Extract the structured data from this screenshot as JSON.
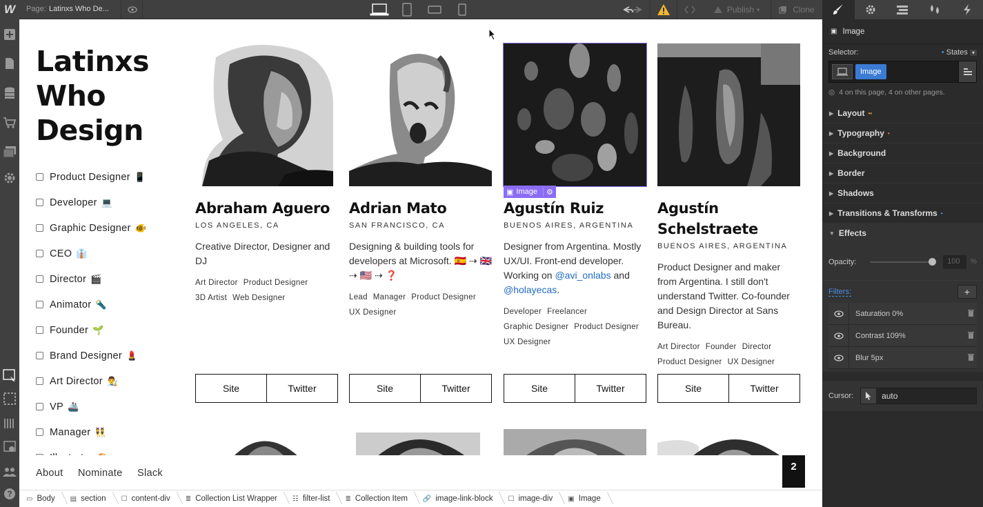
{
  "topbar": {
    "logo": "W",
    "page_label": "Page:",
    "page_name": "Latinxs Who De...",
    "publish_label": "Publish",
    "clone_label": "Clone"
  },
  "site": {
    "title_lines": [
      "Latinxs",
      "Who",
      "Design"
    ],
    "filters": [
      {
        "label": "Product Designer",
        "emoji": "📱"
      },
      {
        "label": "Developer",
        "emoji": "💻"
      },
      {
        "label": "Graphic Designer",
        "emoji": "🐠"
      },
      {
        "label": "CEO",
        "emoji": "👔"
      },
      {
        "label": "Director",
        "emoji": "🎬"
      },
      {
        "label": "Animator",
        "emoji": "🔦"
      },
      {
        "label": "Founder",
        "emoji": "🌱"
      },
      {
        "label": "Brand Designer",
        "emoji": "💄"
      },
      {
        "label": "Art Director",
        "emoji": "👨‍🎨"
      },
      {
        "label": "VP",
        "emoji": "🚢"
      },
      {
        "label": "Manager",
        "emoji": "👯"
      },
      {
        "label": "Illustrator",
        "emoji": "🎨"
      }
    ],
    "cards": [
      {
        "name": "Abraham Aguero",
        "location": "LOS ANGELES, CA",
        "bio": "Creative Director, Designer and DJ",
        "tags": [
          "Art Director",
          "Product Designer",
          "3D Artist",
          "Web Designer"
        ],
        "site_label": "Site",
        "twitter_label": "Twitter"
      },
      {
        "name": "Adrian Mato",
        "location": "SAN FRANCISCO, CA",
        "bio": "Designing & building tools for developers at Microsoft. 🇪🇸 ⇢ 🇬🇧 ⇢ 🇺🇸 ⇢ ❓",
        "tags": [
          "Lead",
          "Manager",
          "Product Designer",
          "UX Designer"
        ],
        "site_label": "Site",
        "twitter_label": "Twitter"
      },
      {
        "name": "Agustín Ruiz",
        "location": "BUENOS AIRES, ARGENTINA",
        "bio_prefix": "Designer from Argentina. Mostly UX/UI. Front-end developer. Working on",
        "link1": "@avi_onlabs",
        "bio_mid": "and",
        "link2": "@holayecas",
        "bio_suffix": ".",
        "tags": [
          "Developer",
          "Freelancer",
          "Graphic Designer",
          "Product Designer",
          "UX Designer"
        ],
        "site_label": "Site",
        "twitter_label": "Twitter"
      },
      {
        "name": "Agustín Schelstraete",
        "location": "BUENOS AIRES, ARGENTINA",
        "bio": "Product Designer and maker from Argentina. I still don't understand Twitter. Co-founder and Design Director at Sans Bureau.",
        "tags": [
          "Art Director",
          "Founder",
          "Director",
          "Product Designer",
          "UX Designer"
        ],
        "site_label": "Site",
        "twitter_label": "Twitter"
      }
    ],
    "selected_tag": "Image",
    "footer_links": [
      "About",
      "Nominate",
      "Slack"
    ],
    "page_number": "2"
  },
  "breadcrumbs": [
    {
      "label": "Body",
      "icon": "▭"
    },
    {
      "label": "section",
      "icon": "▤"
    },
    {
      "label": "content-div",
      "icon": "☐"
    },
    {
      "label": "Collection List Wrapper",
      "icon": "≣"
    },
    {
      "label": "filter-list",
      "icon": "☷"
    },
    {
      "label": "Collection Item",
      "icon": "≣"
    },
    {
      "label": "image-link-block",
      "icon": "🔗"
    },
    {
      "label": "image-div",
      "icon": "☐"
    },
    {
      "label": "Image",
      "icon": "▣"
    }
  ],
  "panel": {
    "element_label": "Image",
    "selector_label": "Selector:",
    "states_label": "States",
    "selector_chip": "Image",
    "on_page_text": "4 on this page, 4 on other pages.",
    "sections": [
      {
        "label": "Layout",
        "ind": "••",
        "color": "#e8a33c"
      },
      {
        "label": "Typography",
        "ind": "•",
        "color": "#e8813c"
      },
      {
        "label": "Background",
        "ind": "",
        "color": ""
      },
      {
        "label": "Border",
        "ind": "",
        "color": ""
      },
      {
        "label": "Shadows",
        "ind": "",
        "color": ""
      },
      {
        "label": "Transitions & Transforms",
        "ind": "•",
        "color": "#4a90e2"
      }
    ],
    "effects_label": "Effects",
    "opacity_label": "Opacity:",
    "opacity_value": "100",
    "opacity_unit": "%",
    "filters_label": "Filters:",
    "filter_items": [
      "Saturation 0%",
      "Contrast 109%",
      "Blur 5px"
    ],
    "cursor_label": "Cursor:",
    "cursor_value": "auto"
  }
}
